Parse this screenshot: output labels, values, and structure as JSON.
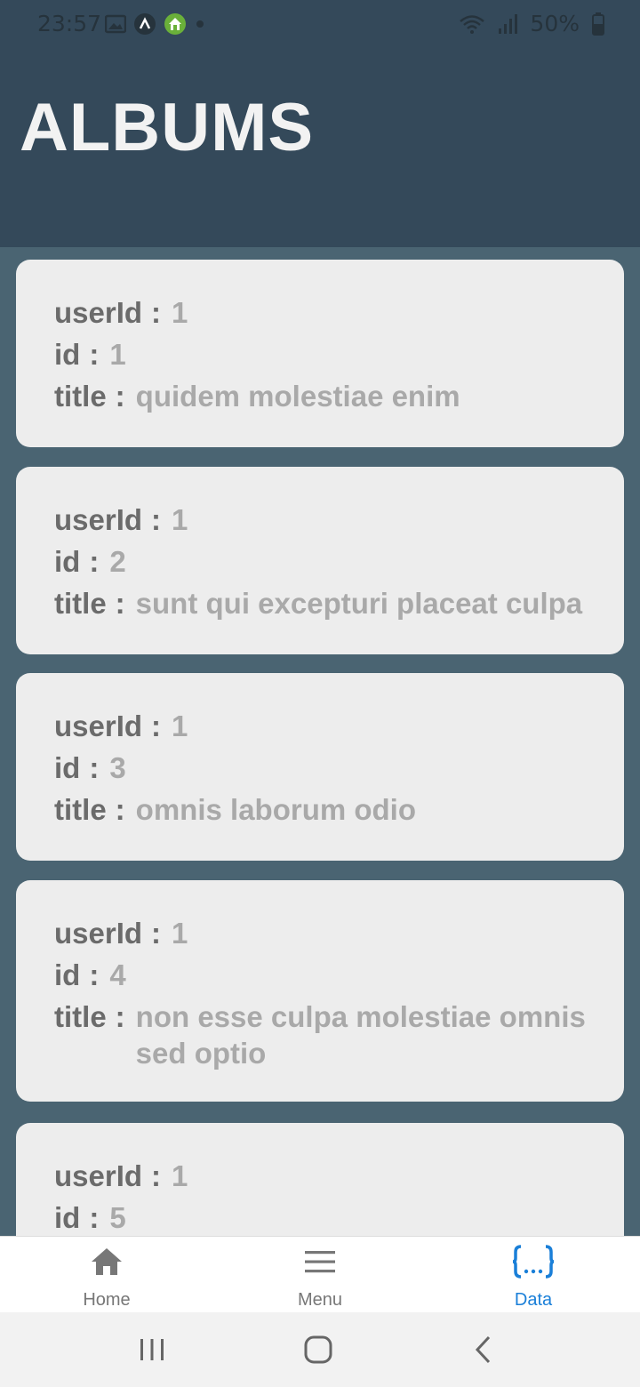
{
  "status": {
    "time": "23:57",
    "battery": "50%",
    "left_icons": [
      "image-icon",
      "app-a-icon",
      "home-app-icon",
      "dot-icon"
    ],
    "right_icons": [
      "wifi-icon",
      "signal-icon",
      "battery-icon"
    ]
  },
  "header": {
    "title": "ALBUMS"
  },
  "labels": {
    "userId": "userId",
    "id": "id",
    "title": "title",
    "sep": ":"
  },
  "albums": [
    {
      "userId": "1",
      "id": "1",
      "title": "quidem molestiae enim"
    },
    {
      "userId": "1",
      "id": "2",
      "title": "sunt qui excepturi placeat culpa"
    },
    {
      "userId": "1",
      "id": "3",
      "title": "omnis laborum odio"
    },
    {
      "userId": "1",
      "id": "4",
      "title": "non esse culpa molestiae omnis sed optio"
    },
    {
      "userId": "1",
      "id": "5",
      "title": ""
    }
  ],
  "nav": {
    "items": [
      {
        "label": "Home",
        "icon": "home-icon"
      },
      {
        "label": "Menu",
        "icon": "menu-icon"
      },
      {
        "label": "Data",
        "icon": "braces-icon"
      }
    ],
    "active": "Data",
    "accent": "#1a7fd8"
  },
  "colors": {
    "header": "#34495a",
    "background": "#4a6472",
    "card": "#ededed"
  }
}
